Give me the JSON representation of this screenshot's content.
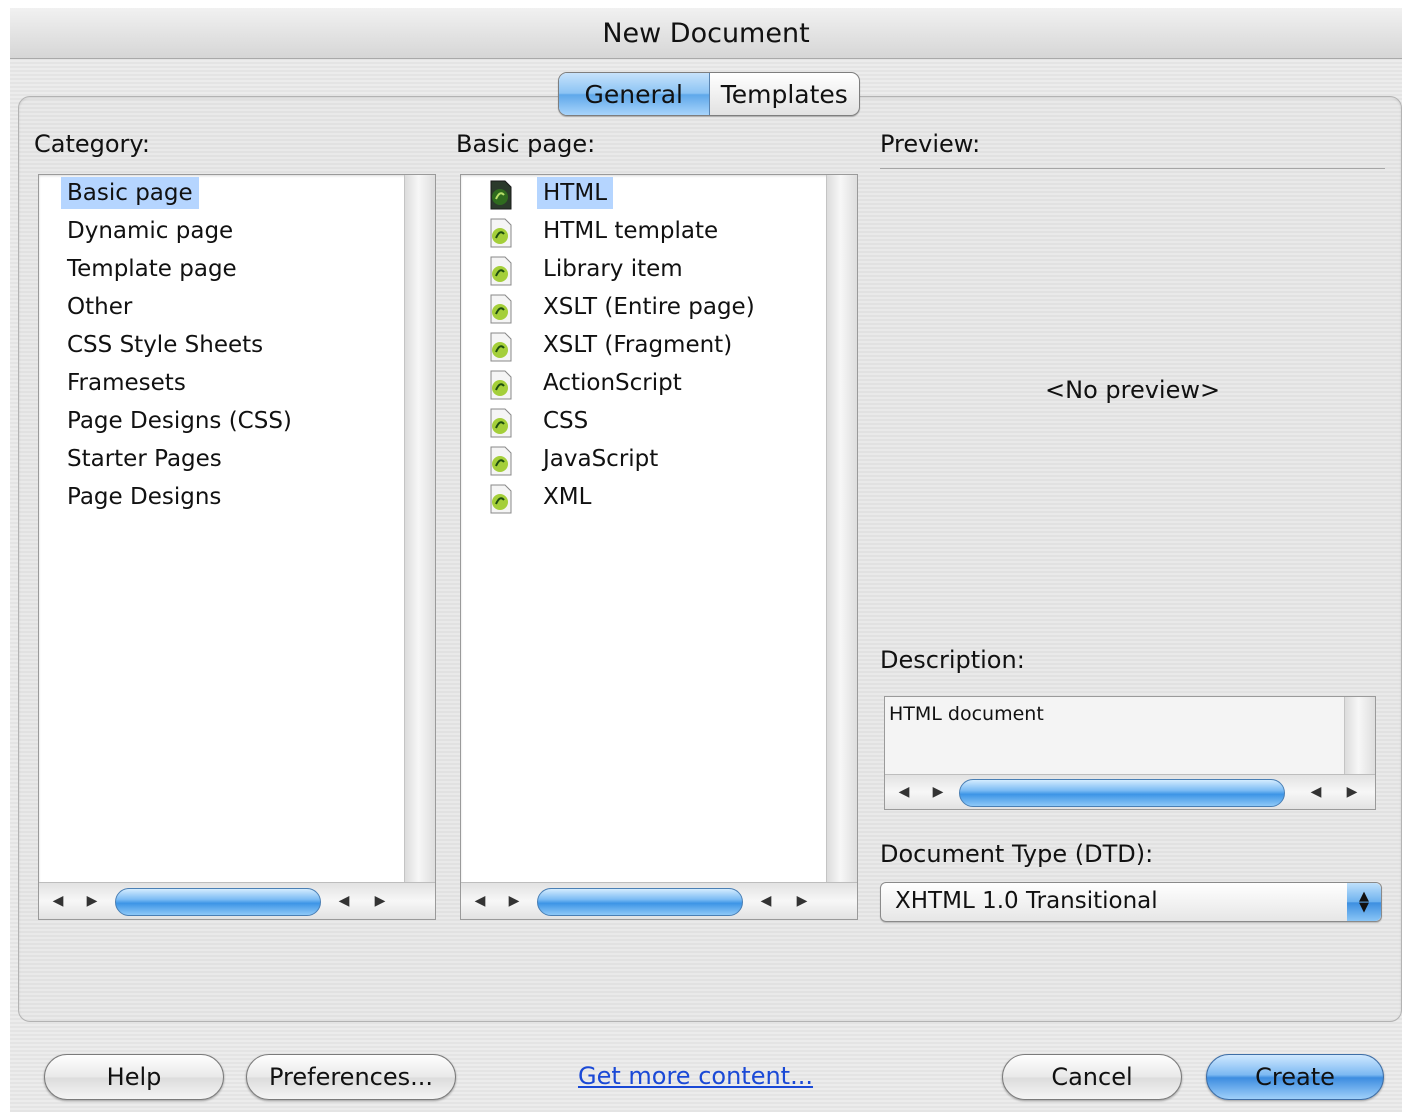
{
  "window": {
    "title": "New Document"
  },
  "tabs": [
    {
      "label": "General",
      "active": true
    },
    {
      "label": "Templates",
      "active": false
    }
  ],
  "category": {
    "label": "Category:",
    "items": [
      "Basic page",
      "Dynamic page",
      "Template page",
      "Other",
      "CSS Style Sheets",
      "Framesets",
      "Page Designs (CSS)",
      "Starter Pages",
      "Page Designs"
    ],
    "selected": "Basic page"
  },
  "basic_page": {
    "label": "Basic page:",
    "items": [
      "HTML",
      "HTML template",
      "Library item",
      "XSLT (Entire page)",
      "XSLT (Fragment)",
      "ActionScript",
      "CSS",
      "JavaScript",
      "XML"
    ],
    "selected": "HTML"
  },
  "preview": {
    "label": "Preview:",
    "placeholder": "<No preview>"
  },
  "description": {
    "label": "Description:",
    "text": "HTML document"
  },
  "doctype": {
    "label": "Document Type (DTD):",
    "value": "XHTML 1.0 Transitional"
  },
  "buttons": {
    "help": "Help",
    "preferences": "Preferences...",
    "get_more": "Get more content...",
    "cancel": "Cancel",
    "create": "Create"
  },
  "colors": {
    "selection": "#b5d5ff",
    "aqua_blue": "#3d8de0",
    "link": "#1a49d6"
  }
}
